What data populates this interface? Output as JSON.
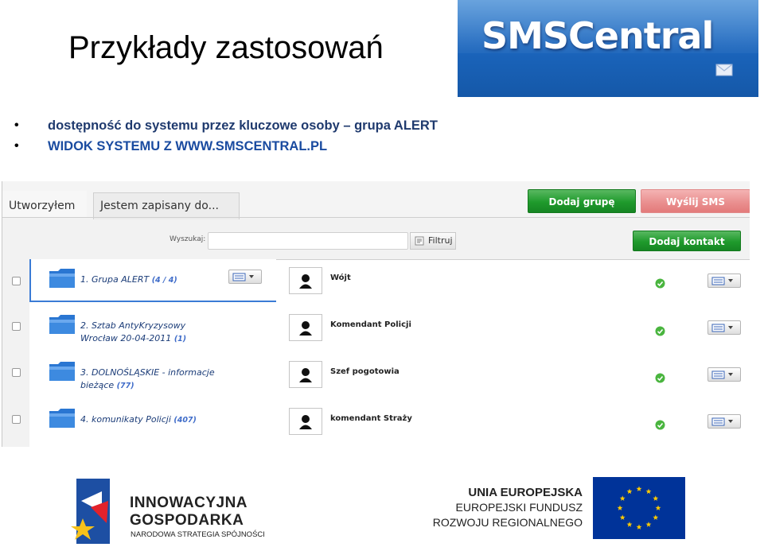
{
  "slide": {
    "title": "Przykłady zastosowań",
    "bullets": [
      "dostępność do systemu przez kluczowe osoby – grupa ALERT",
      "WIDOK SYSTEMU Z WWW.SMSCENTRAL.PL"
    ],
    "bullet_marker": "•"
  },
  "logo": {
    "text": "SMSCentral"
  },
  "app": {
    "tabs": [
      {
        "label": "Utworzyłem"
      },
      {
        "label": "Jestem zapisany do..."
      }
    ],
    "buttons": {
      "add_group": "Dodaj grupę",
      "send_sms": "Wyślij SMS",
      "add_contact": "Dodaj kontakt",
      "filter": "Filtruj"
    },
    "search": {
      "label": "Wyszukaj:",
      "value": ""
    },
    "groups": [
      {
        "name": "1. Grupa ALERT",
        "count": "(4 / 4)",
        "line2": "",
        "selected": true
      },
      {
        "name": "2. Sztab AntyKryzysowy",
        "line2": "Wrocław 20-04-2011",
        "count": "(1)",
        "selected": false
      },
      {
        "name": "3. DOLNOŚLĄSKIE - informacje",
        "line2": "bieżące",
        "count": "(77)",
        "selected": false
      },
      {
        "name": "4. komunikaty Policji",
        "count": "(407)",
        "line2": "",
        "selected": false
      }
    ],
    "contacts": [
      {
        "name": "Wójt"
      },
      {
        "name": "Komendant Policji"
      },
      {
        "name": "Szef pogotowia"
      },
      {
        "name": "komendant Straży"
      }
    ]
  },
  "footer": {
    "ig": {
      "line1": "INNOWACYJNA",
      "line2": "GOSPODARKA",
      "line3": "NARODOWA STRATEGIA SPÓJNOŚCI"
    },
    "eu": {
      "line1": "UNIA EUROPEJSKA",
      "line2": "EUROPEJSKI FUNDUSZ",
      "line3": "ROZWOJU REGIONALNEGO"
    }
  },
  "colors": {
    "accent_green": "#1f9a2c",
    "accent_red": "#e98d8d",
    "logo_blue": "#1b66be",
    "eu_blue": "#003399",
    "eu_star": "#ffcc00"
  }
}
